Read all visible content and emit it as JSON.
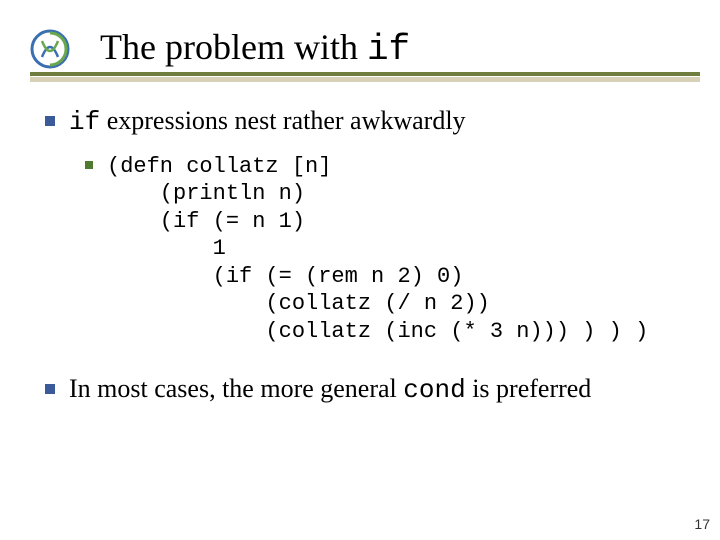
{
  "title": {
    "prefix": "The problem with ",
    "code": "if"
  },
  "bullets": {
    "b1": {
      "code": "if",
      "text": " expressions nest rather awkwardly"
    },
    "code_lines": [
      "(defn collatz [n]",
      "    (println n)",
      "    (if (= n 1)",
      "        1",
      "        (if (= (rem n 2) 0)",
      "            (collatz (/ n 2))",
      "            (collatz (inc (* 3 n))) ) ) )"
    ],
    "b2": {
      "prefix": "In most cases, the more general ",
      "code": "cond",
      "suffix": " is preferred"
    }
  },
  "page_number": "17"
}
